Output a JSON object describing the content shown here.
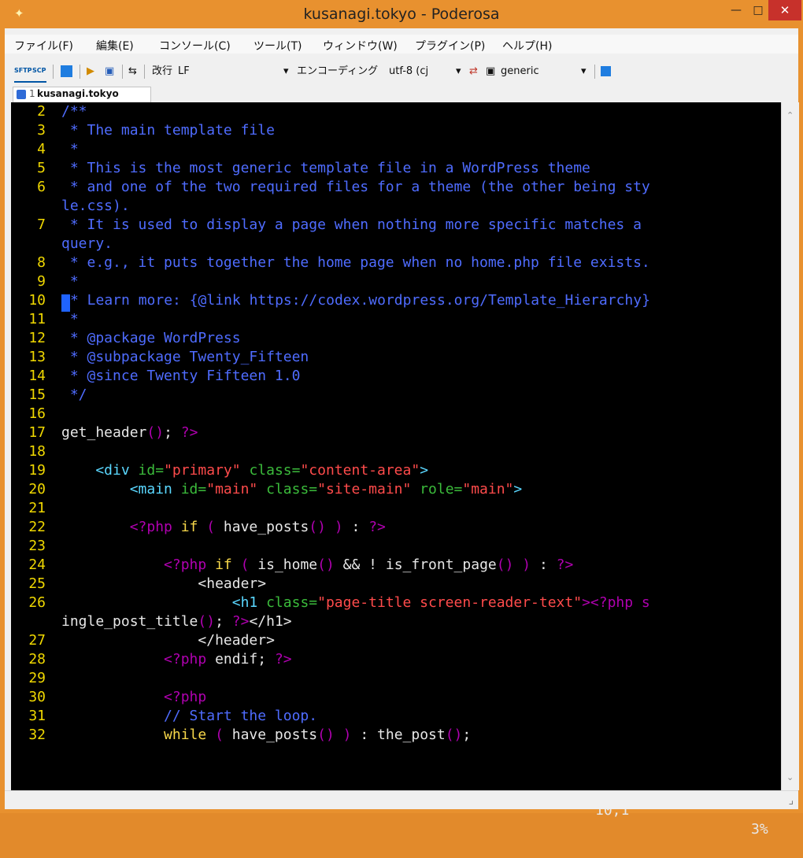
{
  "window": {
    "title": "kusanagi.tokyo - Poderosa",
    "minimize": "—",
    "maximize": "□",
    "close": "✕"
  },
  "menu": [
    "ファイル(F)",
    "編集(E)",
    "コンソール(C)",
    "ツール(T)",
    "ウィンドウ(W)",
    "プラグイン(P)",
    "ヘルプ(H)"
  ],
  "toolbar": {
    "sftp": "SFTP",
    "scp": "SCP",
    "newline_label": "改行",
    "newline_value": "LF",
    "encoding_label": "エンコーディング",
    "encoding_value": "utf-8 (cj",
    "terminal_type": "generic"
  },
  "tabs": [
    {
      "index": "1",
      "label": "kusanagi.tokyo"
    }
  ],
  "editor": {
    "cursor_position": "10,1",
    "scroll_percent": "3%",
    "lines": [
      {
        "number": "2",
        "segments": [
          {
            "text": "/**",
            "cls": "comment"
          }
        ]
      },
      {
        "number": "3",
        "segments": [
          {
            "text": " * The main template file",
            "cls": "comment"
          }
        ]
      },
      {
        "number": "4",
        "segments": [
          {
            "text": " *",
            "cls": "comment"
          }
        ]
      },
      {
        "number": "5",
        "segments": [
          {
            "text": " * This is the most generic template file in a WordPress theme",
            "cls": "comment"
          }
        ]
      },
      {
        "number": "6",
        "segments": [
          {
            "text": " * and one of the two required files for a theme (the other being sty",
            "cls": "comment"
          }
        ]
      },
      {
        "number": "",
        "segments": [
          {
            "text": "le.css).",
            "cls": "comment"
          }
        ]
      },
      {
        "number": "7",
        "segments": [
          {
            "text": " * It is used to display a page when nothing more specific matches a",
            "cls": "comment"
          }
        ]
      },
      {
        "number": "",
        "segments": [
          {
            "text": "query.",
            "cls": "comment"
          }
        ]
      },
      {
        "number": "8",
        "segments": [
          {
            "text": " * e.g., it puts together the home page when no home.php file exists.",
            "cls": "comment"
          }
        ]
      },
      {
        "number": "9",
        "segments": [
          {
            "text": " *",
            "cls": "comment"
          }
        ]
      },
      {
        "number": "10",
        "segments": [
          {
            "text": " ",
            "cls": "cursor"
          },
          {
            "text": "* Learn more: {@link https://codex.wordpress.org/Template_Hierarchy}",
            "cls": "comment"
          }
        ]
      },
      {
        "number": "11",
        "segments": [
          {
            "text": " *",
            "cls": "comment"
          }
        ]
      },
      {
        "number": "12",
        "segments": [
          {
            "text": " * @package WordPress",
            "cls": "comment"
          }
        ]
      },
      {
        "number": "13",
        "segments": [
          {
            "text": " * @subpackage Twenty_Fifteen",
            "cls": "comment"
          }
        ]
      },
      {
        "number": "14",
        "segments": [
          {
            "text": " * @since Twenty Fifteen 1.0",
            "cls": "comment"
          }
        ]
      },
      {
        "number": "15",
        "segments": [
          {
            "text": " */",
            "cls": "comment"
          }
        ]
      },
      {
        "number": "16",
        "segments": [
          {
            "text": "",
            "cls": ""
          }
        ]
      },
      {
        "number": "17",
        "segments": [
          {
            "text": "get_header",
            "cls": ""
          },
          {
            "text": "()",
            "cls": "punc"
          },
          {
            "text": "; ",
            "cls": ""
          },
          {
            "text": "?>",
            "cls": "punc"
          }
        ]
      },
      {
        "number": "18",
        "segments": [
          {
            "text": "",
            "cls": ""
          }
        ]
      },
      {
        "number": "19",
        "segments": [
          {
            "text": "    <div ",
            "cls": "tag"
          },
          {
            "text": "id=",
            "cls": "attr"
          },
          {
            "text": "\"primary\"",
            "cls": "str"
          },
          {
            "text": " class=",
            "cls": "attr"
          },
          {
            "text": "\"content-area\"",
            "cls": "str"
          },
          {
            "text": ">",
            "cls": "tag"
          }
        ]
      },
      {
        "number": "20",
        "segments": [
          {
            "text": "        <main ",
            "cls": "tag"
          },
          {
            "text": "id=",
            "cls": "attr"
          },
          {
            "text": "\"main\"",
            "cls": "str"
          },
          {
            "text": " class=",
            "cls": "attr"
          },
          {
            "text": "\"site-main\"",
            "cls": "str"
          },
          {
            "text": " role=",
            "cls": "attr"
          },
          {
            "text": "\"main\"",
            "cls": "str"
          },
          {
            "text": ">",
            "cls": "tag"
          }
        ]
      },
      {
        "number": "21",
        "segments": [
          {
            "text": "",
            "cls": ""
          }
        ]
      },
      {
        "number": "22",
        "segments": [
          {
            "text": "        <?php ",
            "cls": "punc"
          },
          {
            "text": "if",
            "cls": "kw"
          },
          {
            "text": " ( ",
            "cls": "punc"
          },
          {
            "text": "have_posts",
            "cls": ""
          },
          {
            "text": "()",
            "cls": "punc"
          },
          {
            "text": " ) ",
            "cls": "punc"
          },
          {
            "text": ": ",
            "cls": ""
          },
          {
            "text": "?>",
            "cls": "punc"
          }
        ]
      },
      {
        "number": "23",
        "segments": [
          {
            "text": "",
            "cls": ""
          }
        ]
      },
      {
        "number": "24",
        "segments": [
          {
            "text": "            <?php ",
            "cls": "punc"
          },
          {
            "text": "if",
            "cls": "kw"
          },
          {
            "text": " ( ",
            "cls": "punc"
          },
          {
            "text": "is_home",
            "cls": ""
          },
          {
            "text": "()",
            "cls": "punc"
          },
          {
            "text": " && ! ",
            "cls": ""
          },
          {
            "text": "is_front_page",
            "cls": ""
          },
          {
            "text": "()",
            "cls": "punc"
          },
          {
            "text": " ) ",
            "cls": "punc"
          },
          {
            "text": ": ",
            "cls": ""
          },
          {
            "text": "?>",
            "cls": "punc"
          }
        ]
      },
      {
        "number": "25",
        "segments": [
          {
            "text": "                <header>",
            "cls": ""
          }
        ]
      },
      {
        "number": "26",
        "segments": [
          {
            "text": "                    <h1 ",
            "cls": "tag"
          },
          {
            "text": "class=",
            "cls": "attr"
          },
          {
            "text": "\"page-title screen-reader-text\"",
            "cls": "str"
          },
          {
            "text": "><?php s",
            "cls": "punc"
          }
        ]
      },
      {
        "number": "",
        "segments": [
          {
            "text": "ingle_post_title",
            "cls": ""
          },
          {
            "text": "()",
            "cls": "punc"
          },
          {
            "text": "; ",
            "cls": ""
          },
          {
            "text": "?>",
            "cls": "punc"
          },
          {
            "text": "</h1>",
            "cls": ""
          }
        ]
      },
      {
        "number": "27",
        "segments": [
          {
            "text": "                </header>",
            "cls": ""
          }
        ]
      },
      {
        "number": "28",
        "segments": [
          {
            "text": "            <?php ",
            "cls": "punc"
          },
          {
            "text": "endif",
            "cls": ""
          },
          {
            "text": "; ",
            "cls": ""
          },
          {
            "text": "?>",
            "cls": "punc"
          }
        ]
      },
      {
        "number": "29",
        "segments": [
          {
            "text": "",
            "cls": ""
          }
        ]
      },
      {
        "number": "30",
        "segments": [
          {
            "text": "            <?php",
            "cls": "punc"
          }
        ]
      },
      {
        "number": "31",
        "segments": [
          {
            "text": "            // Start the loop.",
            "cls": "comment"
          }
        ]
      },
      {
        "number": "32",
        "segments": [
          {
            "text": "            ",
            "cls": ""
          },
          {
            "text": "while",
            "cls": "kw"
          },
          {
            "text": " ( ",
            "cls": "punc"
          },
          {
            "text": "have_posts",
            "cls": ""
          },
          {
            "text": "()",
            "cls": "punc"
          },
          {
            "text": " ) ",
            "cls": "punc"
          },
          {
            "text": ": ",
            "cls": ""
          },
          {
            "text": "the_post",
            "cls": ""
          },
          {
            "text": "()",
            "cls": "punc"
          },
          {
            "text": ";",
            "cls": ""
          }
        ]
      }
    ]
  },
  "colors": {
    "titlebar": "#e8912f",
    "terminal_background": "#000000",
    "line_number": "#f0d800",
    "comment": "#4f6cff",
    "cursor": "#1f63ff"
  }
}
